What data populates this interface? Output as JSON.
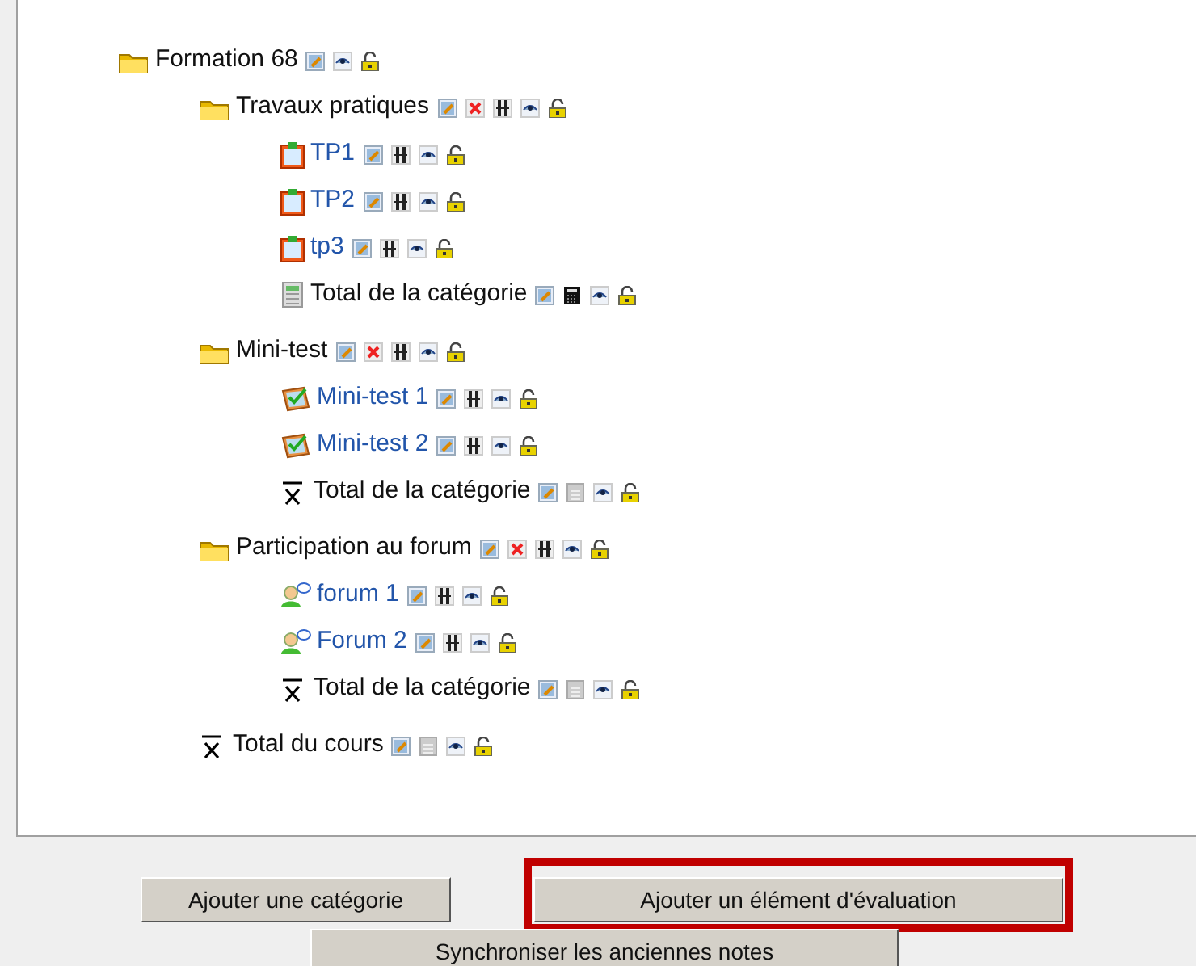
{
  "tree": [
    {
      "kind": "category",
      "label": "Formation 68",
      "link": false,
      "actions": [
        {
          "kind": "edit"
        },
        {
          "kind": "hide"
        },
        {
          "kind": "lock"
        }
      ],
      "children": [
        {
          "kind": "category",
          "label": "Travaux pratiques",
          "link": false,
          "actions": [
            {
              "kind": "edit"
            },
            {
              "kind": "delete"
            },
            {
              "kind": "move"
            },
            {
              "kind": "hide"
            },
            {
              "kind": "lock"
            }
          ],
          "children": [
            {
              "kind": "assignment",
              "label": "TP1",
              "link": true,
              "actions": [
                {
                  "kind": "edit"
                },
                {
                  "kind": "move"
                },
                {
                  "kind": "hide"
                },
                {
                  "kind": "lock"
                }
              ]
            },
            {
              "kind": "assignment",
              "label": "TP2",
              "link": true,
              "actions": [
                {
                  "kind": "edit"
                },
                {
                  "kind": "move"
                },
                {
                  "kind": "hide"
                },
                {
                  "kind": "lock"
                }
              ]
            },
            {
              "kind": "assignment",
              "label": "tp3",
              "link": true,
              "actions": [
                {
                  "kind": "edit"
                },
                {
                  "kind": "move"
                },
                {
                  "kind": "hide"
                },
                {
                  "kind": "lock"
                }
              ]
            },
            {
              "kind": "calc_total",
              "label": "Total de la catégorie",
              "link": false,
              "actions": [
                {
                  "kind": "edit"
                },
                {
                  "kind": "calculator"
                },
                {
                  "kind": "hide"
                },
                {
                  "kind": "lock"
                }
              ]
            }
          ]
        },
        {
          "kind": "category",
          "label": "Mini-test",
          "link": false,
          "actions": [
            {
              "kind": "edit"
            },
            {
              "kind": "delete"
            },
            {
              "kind": "move"
            },
            {
              "kind": "hide"
            },
            {
              "kind": "lock"
            }
          ],
          "children": [
            {
              "kind": "quiz",
              "label": "Mini-test 1",
              "link": true,
              "actions": [
                {
                  "kind": "edit"
                },
                {
                  "kind": "move"
                },
                {
                  "kind": "hide"
                },
                {
                  "kind": "lock"
                }
              ]
            },
            {
              "kind": "quiz",
              "label": "Mini-test 2",
              "link": true,
              "actions": [
                {
                  "kind": "edit"
                },
                {
                  "kind": "move"
                },
                {
                  "kind": "hide"
                },
                {
                  "kind": "lock"
                }
              ]
            },
            {
              "kind": "mean_total",
              "label": "Total de la catégorie",
              "link": false,
              "actions": [
                {
                  "kind": "edit"
                },
                {
                  "kind": "calculator_off"
                },
                {
                  "kind": "hide"
                },
                {
                  "kind": "lock"
                }
              ]
            }
          ]
        },
        {
          "kind": "category",
          "label": "Participation au forum",
          "link": false,
          "actions": [
            {
              "kind": "edit"
            },
            {
              "kind": "delete"
            },
            {
              "kind": "move"
            },
            {
              "kind": "hide"
            },
            {
              "kind": "lock"
            }
          ],
          "children": [
            {
              "kind": "forum",
              "label": "forum 1",
              "link": true,
              "actions": [
                {
                  "kind": "edit"
                },
                {
                  "kind": "move"
                },
                {
                  "kind": "hide"
                },
                {
                  "kind": "lock"
                }
              ]
            },
            {
              "kind": "forum",
              "label": "Forum 2",
              "link": true,
              "actions": [
                {
                  "kind": "edit"
                },
                {
                  "kind": "move"
                },
                {
                  "kind": "hide"
                },
                {
                  "kind": "lock"
                }
              ]
            },
            {
              "kind": "mean_total",
              "label": "Total de la catégorie",
              "link": false,
              "actions": [
                {
                  "kind": "edit"
                },
                {
                  "kind": "calculator_off"
                },
                {
                  "kind": "hide"
                },
                {
                  "kind": "lock"
                }
              ]
            }
          ]
        },
        {
          "kind": "mean_total",
          "label": "Total du cours",
          "link": false,
          "actions": [
            {
              "kind": "edit"
            },
            {
              "kind": "calculator_off"
            },
            {
              "kind": "hide"
            },
            {
              "kind": "lock"
            }
          ]
        }
      ]
    }
  ],
  "buttons": [
    {
      "label": "Ajouter une catégorie",
      "highlighted": false
    },
    {
      "label": "Ajouter un élément d'évaluation",
      "highlighted": true
    },
    {
      "label": "Synchroniser les anciennes notes",
      "highlighted": false
    }
  ]
}
